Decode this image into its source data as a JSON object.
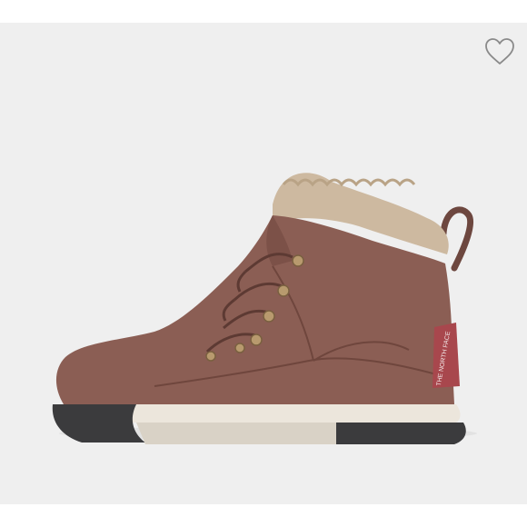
{
  "product": {
    "image_alt": "Brown leather lace-up winter boot with faux fur collar, red heel tab and black-and-cream sole",
    "brand_mark": "THE NORTH FACE",
    "favorited": false
  },
  "favorite": {
    "label": "Add to favorites",
    "icon": "heart-outline-icon"
  },
  "colors": {
    "panel_bg": "#efefef",
    "boot_leather": "#8b5e54",
    "fur_lining": "#cdb9a0",
    "heel_tab": "#a8474d",
    "midsole": "#ece6dc",
    "outsole": "#3b3b3d",
    "heart_stroke": "#8a8a8a"
  }
}
